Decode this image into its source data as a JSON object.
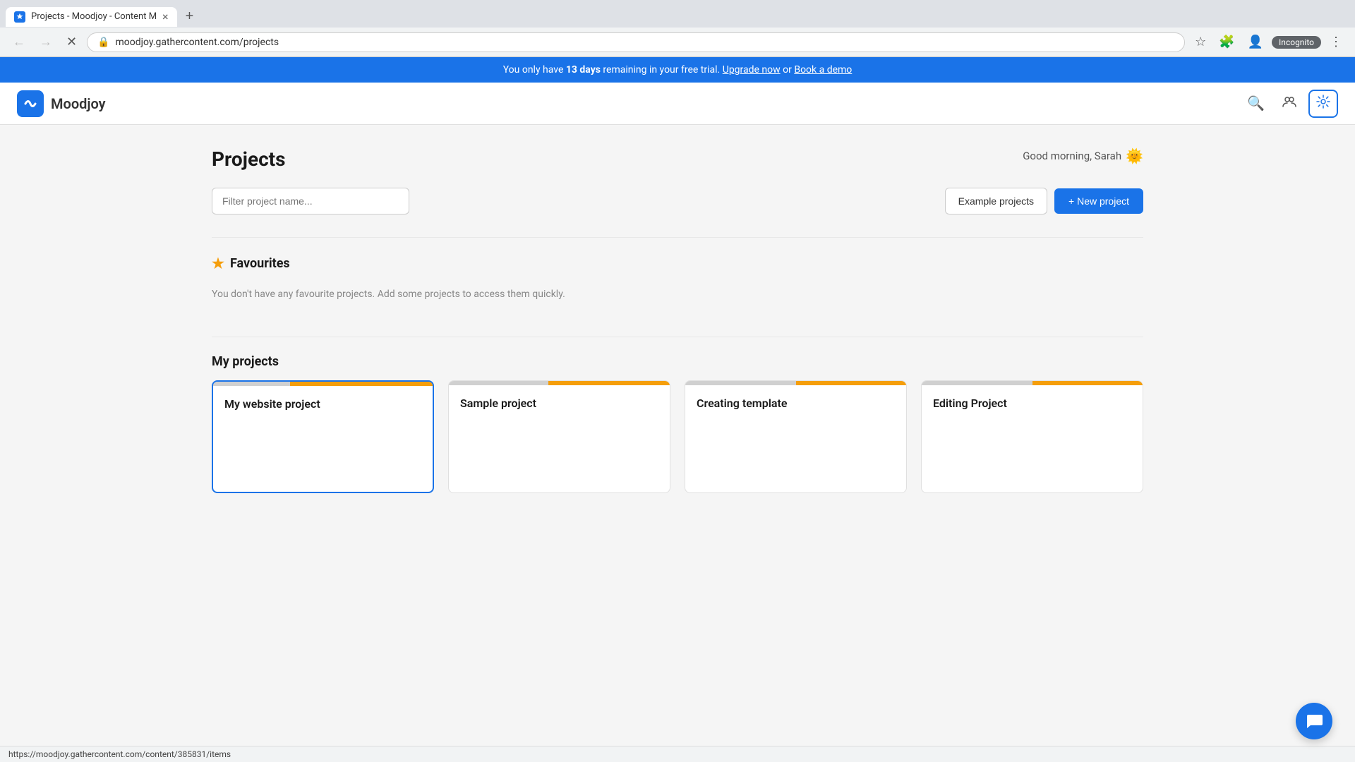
{
  "browser": {
    "tab_label": "Projects - Moodjoy - Content M",
    "tab_close": "×",
    "tab_new": "+",
    "nav_back": "←",
    "nav_forward": "→",
    "nav_reload": "✕",
    "address": "moodjoy.gathercontent.com/projects",
    "incognito_label": "Incognito",
    "status_url": "https://moodjoy.gathercontent.com/content/385831/items"
  },
  "trial_banner": {
    "prefix": "You only have ",
    "days": "13 days",
    "suffix": " remaining in your free trial.",
    "upgrade_label": "Upgrade now",
    "middle": " or ",
    "demo_label": "Book a demo"
  },
  "header": {
    "logo_text": "Moodjoy",
    "logo_icon": "✓",
    "search_icon": "🔍",
    "people_icon": "👥",
    "gear_icon": "⚙"
  },
  "page": {
    "title": "Projects",
    "greeting": "Good morning, Sarah",
    "greeting_emoji": "🌞",
    "filter_placeholder": "Filter project name...",
    "example_projects_label": "Example projects",
    "new_project_label": "+ New project"
  },
  "favourites": {
    "section_title": "Favourites",
    "empty_message": "You don't have any favourite projects. Add some projects to access them quickly."
  },
  "my_projects": {
    "section_title": "My projects",
    "cards": [
      {
        "name": "My website project",
        "progress_yellow": 65,
        "progress_gray": 35
      },
      {
        "name": "Sample project",
        "progress_yellow": 55,
        "progress_gray": 45
      },
      {
        "name": "Creating template",
        "progress_yellow": 50,
        "progress_gray": 50
      },
      {
        "name": "Editing Project",
        "progress_yellow": 50,
        "progress_gray": 50
      }
    ]
  },
  "chat_icon": "💬"
}
